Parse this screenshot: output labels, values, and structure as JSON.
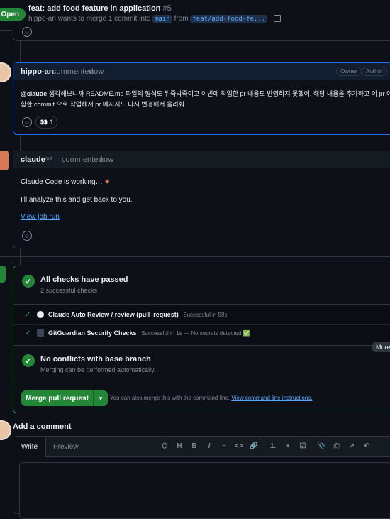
{
  "header": {
    "status": "Open",
    "title": "feat: add food feature in application",
    "pr_number": "#5",
    "author": "hippo-an",
    "subtitle_mid": "wants to merge 1 commit into",
    "base_branch": "main",
    "from_word": "from",
    "head_branch": "feat/add-food-fe..."
  },
  "comment1": {
    "author": "hippo-an",
    "action": "commented",
    "time": "now",
    "badges": [
      "Owner",
      "Author"
    ],
    "mention": "@claude",
    "body_line1": "생각해보니까 README.md 파일의 형식도 뒤죽박죽이고 이번에 작업한 pr 내용도 반영하지 못했어. 해당 내용을 추가하고 이 pr 에",
    "body_line2": "함한 commit 으로 작업해서 pr 메시지도 다시 변경해서 올려줘.",
    "reaction_emoji": "👀",
    "reaction_count": "1"
  },
  "comment2": {
    "author": "claude",
    "bot_label": "bot",
    "action": "commented",
    "time": "now",
    "line1": "Claude Code is working…",
    "line2": "I'll analyze this and get back to you.",
    "link": "View job run"
  },
  "checks": {
    "title": "All checks have passed",
    "subtitle": "2 successful checks",
    "items": [
      {
        "name": "Claude Auto Review / review (pull_request)",
        "status": "Successful in 58s"
      },
      {
        "name": "GitGuardian Security Checks",
        "status": "Successful in 1s — No secrets detected ✅"
      }
    ],
    "more_tooltip": "More",
    "conflict_title": "No conflicts with base branch",
    "conflict_sub": "Merging can be performed automatically."
  },
  "merge": {
    "button": "Merge pull request",
    "hint": "You can also merge this with the command line.",
    "hint_link": "View command line instructions."
  },
  "add_comment": {
    "title": "Add a comment",
    "tab_write": "Write",
    "tab_preview": "Preview",
    "tools": [
      "H",
      "B",
      "I",
      "≡",
      "<>",
      "🔗",
      "1.",
      "•",
      "☑",
      "📎",
      "@",
      "↗",
      "↶"
    ]
  },
  "colors": {
    "green": "#238636",
    "link": "#58a6ff",
    "bg": "#0d1117"
  }
}
